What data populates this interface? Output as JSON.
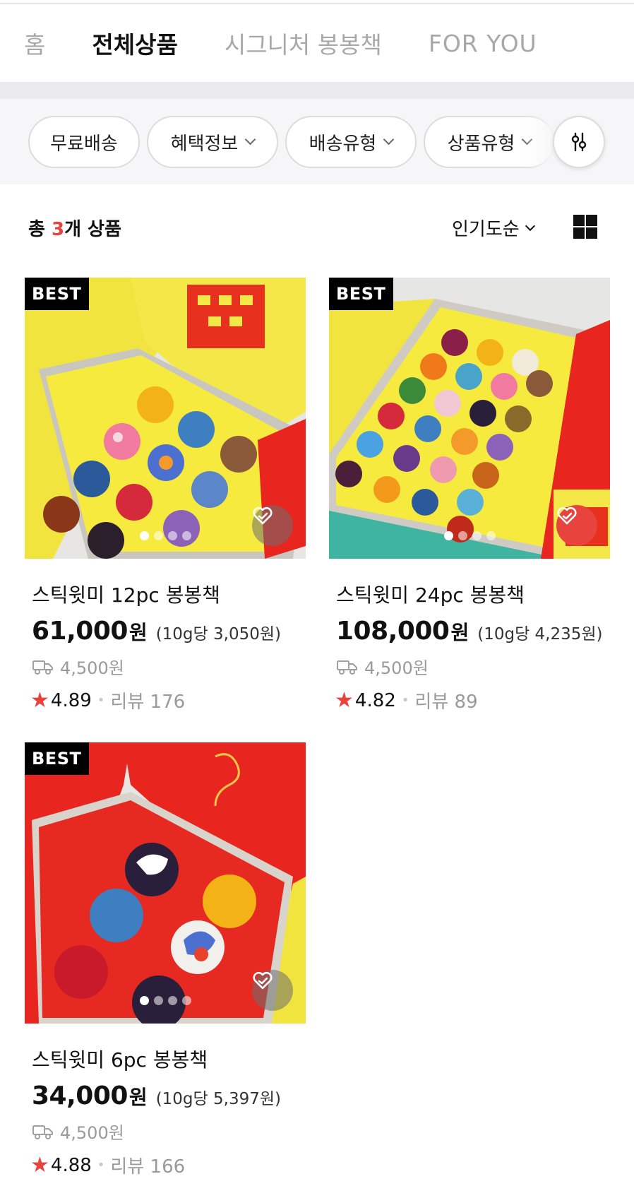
{
  "tabs": [
    {
      "label": "홈"
    },
    {
      "label": "전체상품"
    },
    {
      "label": "시그니처 봉봉책"
    },
    {
      "label": "FOR YOU"
    }
  ],
  "active_tab": "전체상품",
  "filters": [
    {
      "label": "무료배송"
    },
    {
      "label": "혜택정보"
    },
    {
      "label": "배송유형"
    },
    {
      "label": "상품유형"
    }
  ],
  "summary": {
    "prefix": "총 ",
    "count": "3",
    "suffix": "개 상품",
    "sort_label": "인기도순"
  },
  "products": [
    {
      "badge": "BEST",
      "name": "스틱윗미 12pc 봉봉책",
      "price": "61,000",
      "currency": "원",
      "unit_price": "(10g당 3,050원)",
      "shipping": "4,500원",
      "rating": "4.89",
      "review_label": "리뷰 176",
      "liked": false,
      "slide_count": 4,
      "slide_active": 0
    },
    {
      "badge": "BEST",
      "name": "스틱윗미 24pc 봉봉책",
      "price": "108,000",
      "currency": "원",
      "unit_price": "(10g당 4,235원)",
      "shipping": "4,500원",
      "rating": "4.82",
      "review_label": "리뷰 89",
      "liked": true,
      "slide_count": 4,
      "slide_active": 0
    },
    {
      "badge": "BEST",
      "name": "스틱윗미 6pc 봉봉책",
      "price": "34,000",
      "currency": "원",
      "unit_price": "(10g당 5,397원)",
      "shipping": "4,500원",
      "rating": "4.88",
      "review_label": "리뷰 166",
      "liked": false,
      "slide_count": 4,
      "slide_active": 0
    }
  ],
  "colors": {
    "accent": "#e8433c",
    "muted": "#9a9a9a",
    "tab_inactive": "#a8a8a8",
    "box_yellow": "#f1e23a",
    "box_red": "#e8261f"
  },
  "icons": {
    "filter": "sliders-icon",
    "grid": "grid-view-icon",
    "like": "heart-check-icon",
    "shipping": "delivery-truck-icon",
    "rating": "star-icon"
  }
}
